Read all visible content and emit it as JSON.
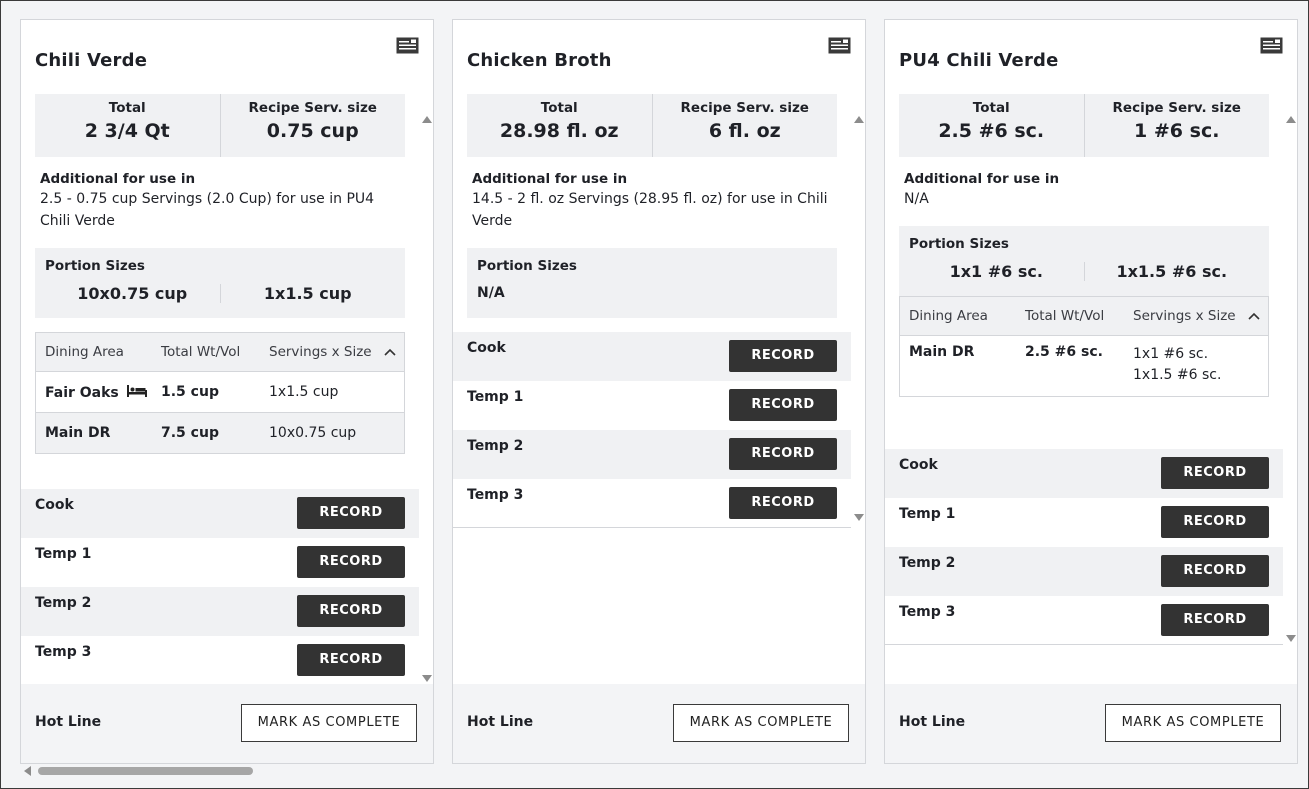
{
  "cards": [
    {
      "title": "Chili Verde",
      "total_label": "Total",
      "total_value": "2 3/4 Qt",
      "serv_label": "Recipe Serv. size",
      "serv_value": "0.75 cup",
      "additional_label": "Additional for use in",
      "additional_text": "2.5 - 0.75 cup Servings (2.0 Cup) for use in PU4 Chili Verde",
      "portion_label": "Portion Sizes",
      "portions": [
        "10x0.75 cup",
        "1x1.5 cup"
      ],
      "dining_headers": [
        "Dining Area",
        "Total Wt/Vol",
        "Servings x Size"
      ],
      "dining_rows": [
        {
          "area": "Fair Oaks",
          "total": "1.5 cup",
          "servings": "1x1.5 cup"
        },
        {
          "area": "Main DR",
          "total": "7.5 cup",
          "servings": "10x0.75 cup"
        }
      ],
      "records": [
        "Cook",
        "Temp 1",
        "Temp 2",
        "Temp 3"
      ],
      "record_button": "RECORD",
      "footer_label": "Hot Line",
      "complete_button": "MARK AS COMPLETE"
    },
    {
      "title": "Chicken Broth",
      "total_label": "Total",
      "total_value": "28.98 fl. oz",
      "serv_label": "Recipe Serv. size",
      "serv_value": "6 fl. oz",
      "additional_label": "Additional for use in",
      "additional_text": "14.5 - 2 fl. oz Servings (28.95 fl. oz) for use in Chili Verde",
      "portion_label": "Portion Sizes",
      "portion_na": "N/A",
      "records": [
        "Cook",
        "Temp 1",
        "Temp 2",
        "Temp 3"
      ],
      "record_button": "RECORD",
      "footer_label": "Hot Line",
      "complete_button": "MARK AS COMPLETE"
    },
    {
      "title": "PU4 Chili Verde",
      "total_label": "Total",
      "total_value": "2.5 #6 sc.",
      "serv_label": "Recipe Serv. size",
      "serv_value": "1 #6 sc.",
      "additional_label": "Additional for use in",
      "additional_text": "N/A",
      "portion_label": "Portion Sizes",
      "portions": [
        "1x1 #6 sc.",
        "1x1.5 #6 sc."
      ],
      "dining_headers": [
        "Dining Area",
        "Total Wt/Vol",
        "Servings x Size"
      ],
      "dining_rows": [
        {
          "area": "Main DR",
          "total": "2.5 #6 sc.",
          "servings_1": "1x1 #6 sc.",
          "servings_2": "1x1.5 #6 sc."
        }
      ],
      "records": [
        "Cook",
        "Temp 1",
        "Temp 2",
        "Temp 3"
      ],
      "record_button": "RECORD",
      "footer_label": "Hot Line",
      "complete_button": "MARK AS COMPLETE"
    }
  ],
  "icons": {
    "print": "print-icon",
    "bed": "bed-icon",
    "chevron": "chevron-up-icon"
  }
}
